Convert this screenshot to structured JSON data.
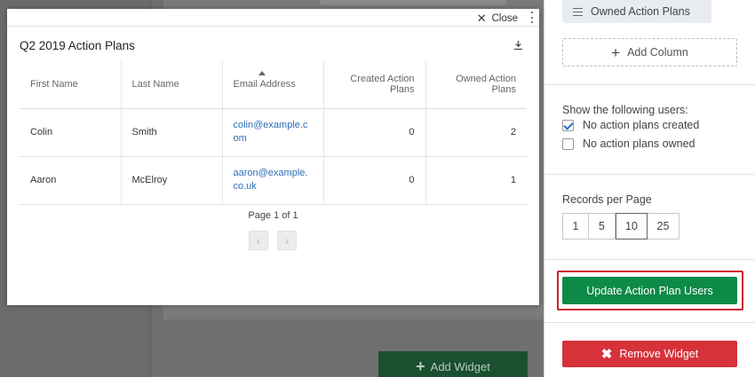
{
  "modal": {
    "close_label": "Close",
    "title": "Q2 2019 Action Plans",
    "columns": [
      "First Name",
      "Last Name",
      "Email Address",
      "Created Action Plans",
      "Owned Action Plans"
    ],
    "rows": [
      {
        "first": "Colin",
        "last": "Smith",
        "email": "colin@example.com",
        "created": "0",
        "owned": "2"
      },
      {
        "first": "Aaron",
        "last": "McElroy",
        "email": "aaron@example.co.uk",
        "created": "0",
        "owned": "1"
      }
    ],
    "pagination": "Page 1 of 1"
  },
  "panel": {
    "owned_pill": "Owned Action Plans",
    "add_column": "Add Column",
    "show_label": "Show the following users:",
    "filters": [
      {
        "label": "No action plans created",
        "checked": true
      },
      {
        "label": "No action plans owned",
        "checked": false
      }
    ],
    "records_label": "Records per Page",
    "records_options": [
      "1",
      "5",
      "10",
      "25"
    ],
    "records_selected": "10",
    "update_button": "Update Action Plan Users",
    "remove_button": "Remove Widget"
  },
  "background": {
    "add_widget": "Add Widget"
  },
  "colors": {
    "update_green": "#0d8a47",
    "remove_red": "#d7323a",
    "highlight_red": "#cc2230",
    "link_blue": "#2a6eb8"
  }
}
